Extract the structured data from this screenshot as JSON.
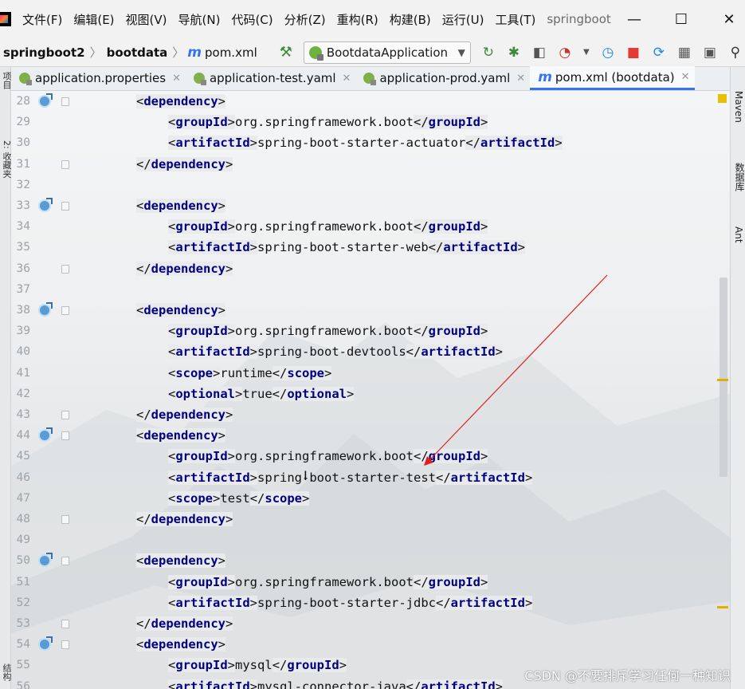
{
  "menubar": {
    "items": [
      "文件(F)",
      "编辑(E)",
      "视图(V)",
      "导航(N)",
      "代码(C)",
      "分析(Z)",
      "重构(R)",
      "构建(B)",
      "运行(U)",
      "工具(T)"
    ],
    "app_title": "springboot",
    "minimize": "—",
    "maximize": "☐",
    "close": "✕"
  },
  "navbar": {
    "crumbs": [
      "springboot2",
      "bootdata"
    ],
    "file": "pom.xml",
    "run_config": "BootdataApplication"
  },
  "tabs": [
    {
      "label": "application.properties",
      "active": false
    },
    {
      "label": "application-test.yaml",
      "active": false
    },
    {
      "label": "application-prod.yaml",
      "active": false
    },
    {
      "label": "pom.xml (bootdata)",
      "active": true
    }
  ],
  "left_strip": {
    "top_label": "项目",
    "bottom_label": "2: 收藏夹",
    "last_label": "结构"
  },
  "right_strip": {
    "maven": "Maven",
    "database": "数据库",
    "ant": "Ant"
  },
  "editor": {
    "lines": [
      {
        "n": "28",
        "indent": 1,
        "tag": "dependency",
        "close": false,
        "value": "",
        "gutter": true,
        "fold": true
      },
      {
        "n": "29",
        "indent": 2,
        "tag": "groupId",
        "close": true,
        "value": "org.springframework.boot",
        "gutter": false,
        "fold": false
      },
      {
        "n": "30",
        "indent": 2,
        "tag": "artifactId",
        "close": true,
        "value": "spring-boot-starter-actuator",
        "gutter": false,
        "fold": false
      },
      {
        "n": "31",
        "indent": 1,
        "tag": "dependency",
        "end": true,
        "gutter": false,
        "fold": true
      },
      {
        "n": "32",
        "blank": true
      },
      {
        "n": "33",
        "indent": 1,
        "tag": "dependency",
        "close": false,
        "value": "",
        "gutter": true,
        "fold": true
      },
      {
        "n": "34",
        "indent": 2,
        "tag": "groupId",
        "close": true,
        "value": "org.springframework.boot"
      },
      {
        "n": "35",
        "indent": 2,
        "tag": "artifactId",
        "close": true,
        "value": "spring-boot-starter-web"
      },
      {
        "n": "36",
        "indent": 1,
        "tag": "dependency",
        "end": true,
        "fold": true
      },
      {
        "n": "37",
        "blank": true
      },
      {
        "n": "38",
        "indent": 1,
        "tag": "dependency",
        "close": false,
        "value": "",
        "gutter": true,
        "fold": true
      },
      {
        "n": "39",
        "indent": 2,
        "tag": "groupId",
        "close": true,
        "value": "org.springframework.boot"
      },
      {
        "n": "40",
        "indent": 2,
        "tag": "artifactId",
        "close": true,
        "value": "spring-boot-devtools"
      },
      {
        "n": "41",
        "indent": 2,
        "tag": "scope",
        "close": true,
        "value": "runtime"
      },
      {
        "n": "42",
        "indent": 2,
        "tag": "optional",
        "close": true,
        "value": "true"
      },
      {
        "n": "43",
        "indent": 1,
        "tag": "dependency",
        "end": true,
        "fold": true
      },
      {
        "n": "44",
        "indent": 1,
        "tag": "dependency",
        "close": false,
        "value": "",
        "gutter": true,
        "fold": true,
        "highlight": true
      },
      {
        "n": "45",
        "indent": 2,
        "tag": "groupId",
        "close": true,
        "value": "org.springframework.boot"
      },
      {
        "n": "46",
        "indent": 2,
        "tag": "artifactId",
        "close": true,
        "value": "spring-boot-starter-test"
      },
      {
        "n": "47",
        "indent": 2,
        "tag": "scope",
        "close": true,
        "value": "test"
      },
      {
        "n": "48",
        "indent": 1,
        "tag": "dependency",
        "end": true,
        "fold": true
      },
      {
        "n": "49",
        "blank": true
      },
      {
        "n": "50",
        "indent": 1,
        "tag": "dependency",
        "close": false,
        "value": "",
        "gutter": true,
        "fold": true
      },
      {
        "n": "51",
        "indent": 2,
        "tag": "groupId",
        "close": true,
        "value": "org.springframework.boot"
      },
      {
        "n": "52",
        "indent": 2,
        "tag": "artifactId",
        "close": true,
        "value": "spring-boot-starter-jdbc"
      },
      {
        "n": "53",
        "indent": 1,
        "tag": "dependency",
        "end": true,
        "fold": true
      },
      {
        "n": "54",
        "indent": 1,
        "tag": "dependency",
        "close": false,
        "value": "",
        "gutter": true,
        "fold": true
      },
      {
        "n": "55",
        "indent": 2,
        "tag": "groupId",
        "close": true,
        "value": "mysql"
      },
      {
        "n": "56",
        "indent": 2,
        "tag": "artifactId",
        "close": true,
        "value": "mysql-connector-java"
      }
    ]
  },
  "watermark": "CSDN @不要排斥学习任何一种知识",
  "colors": {
    "accent": "#3574f0",
    "tag": "#000080",
    "annotation": "#e02020"
  }
}
